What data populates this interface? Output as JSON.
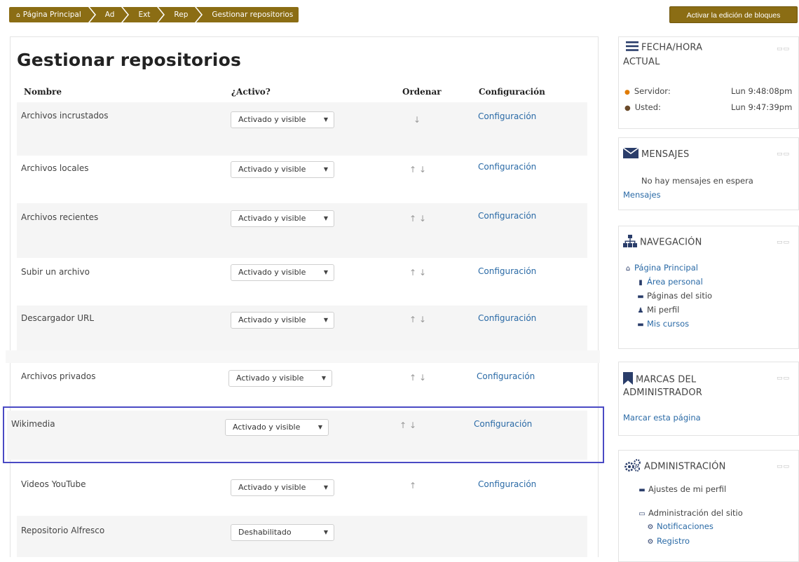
{
  "breadcrumb": [
    {
      "label": "Página Principal",
      "icon": "home-icon"
    },
    {
      "label": "Ad"
    },
    {
      "label": "Ext"
    },
    {
      "label": "Rep"
    },
    {
      "label": "Gestionar repositorios"
    }
  ],
  "header": {
    "edit_blocks_label": "Activar la edición de bloques"
  },
  "page": {
    "title": "Gestionar repositorios"
  },
  "table": {
    "columns": [
      "Nombre",
      "¿Activo?",
      "Ordenar",
      "Configuración"
    ],
    "rows": [
      {
        "name": "Archivos incrustados",
        "status": "Activado y visible",
        "order": "↓",
        "config": "Configuración"
      },
      {
        "name": "Archivos locales",
        "status": "Activado y visible",
        "order": "↑↓",
        "config": "Configuración"
      },
      {
        "name": "Archivos recientes",
        "status": "Activado y visible",
        "order": "↑↓",
        "config": "Configuración"
      },
      {
        "name": "Subir un archivo",
        "status": "Activado y visible",
        "order": "↑↓",
        "config": "Configuración"
      },
      {
        "name": "Descargador URL",
        "status": "Activado y visible",
        "order": "↑↓",
        "config": "Configuración"
      },
      {
        "name": "Archivos privados",
        "status": "Activado y visible",
        "order": "↑↓",
        "config": "Configuración"
      },
      {
        "name": "Wikimedia",
        "status": "Activado y visible",
        "order": "↑↓",
        "config": "Configuración"
      },
      {
        "name": "Videos YouTube",
        "status": "Activado y visible",
        "order": "↑",
        "config": "Configuración"
      },
      {
        "name": "Repositorio Alfresco",
        "status": "Deshabilitado",
        "order": "",
        "config": ""
      }
    ]
  },
  "sidebar": {
    "datetime": {
      "title_line1": "FECHA/HORA",
      "title_line2": "ACTUAL",
      "server_label": "Servidor:",
      "server_time": "Lun 9:48:08pm",
      "user_label": "Usted:",
      "user_time": "Lun 9:47:39pm"
    },
    "messages": {
      "title": "MENSAJES",
      "empty_text": "No hay mensajes en espera",
      "link": "Mensajes"
    },
    "navigation": {
      "title": "NAVEGACIÓN",
      "home": "Página Principal",
      "items": [
        "Área personal",
        "Páginas del sitio",
        "Mi perfil",
        "Mis cursos"
      ]
    },
    "bookmarks": {
      "title_line1": "MARCAS DEL",
      "title_line2": "ADMINISTRADOR",
      "link": "Marcar esta página"
    },
    "admin": {
      "title": "ADMINISTRACIÓN",
      "items": [
        "Ajustes de mi perfil",
        "Administración del sitio"
      ],
      "subitems": [
        "Notificaciones",
        "Registro"
      ]
    }
  },
  "colors": {
    "accent": "#8b6d14",
    "link": "#2a6aa6",
    "highlight": "#4a4ac4"
  }
}
